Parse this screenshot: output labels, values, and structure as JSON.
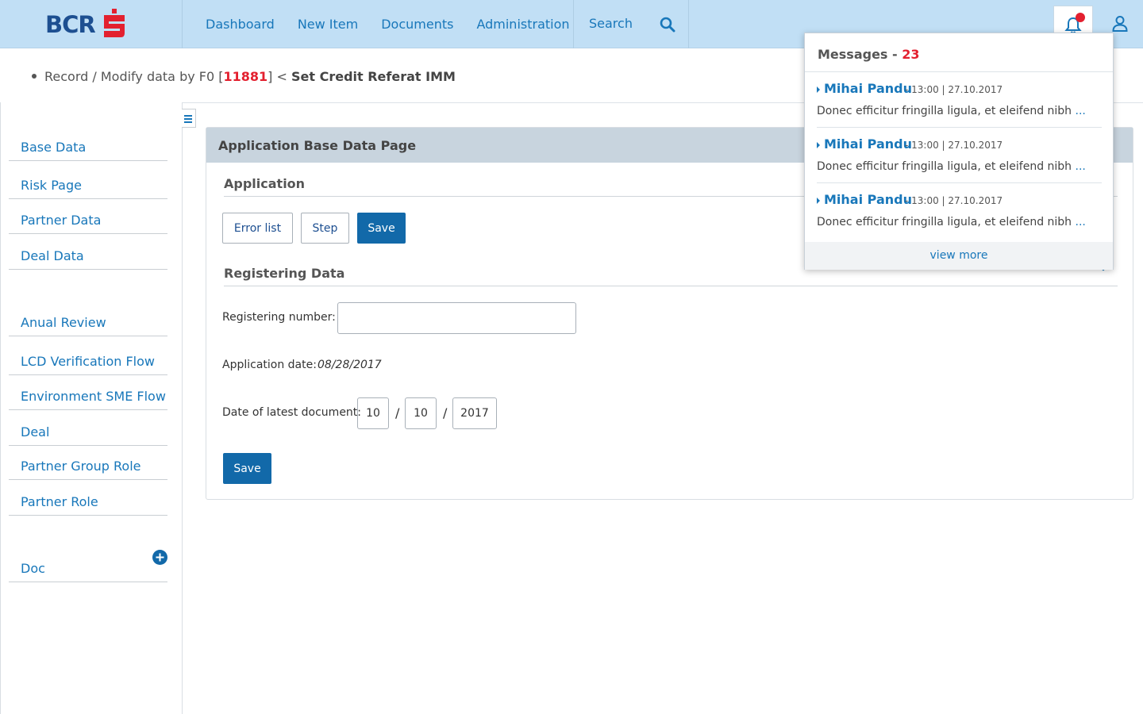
{
  "header": {
    "logo_text": "BCR",
    "brand_color": "#e3202f",
    "nav": [
      "Dashboard",
      "New Item",
      "Documents",
      "Administration"
    ],
    "search_label": "Search"
  },
  "breadcrumb": {
    "prefix": "Record / Modify data by F0 [",
    "record_id": "11881",
    "suffix": "] < ",
    "title": "Set Credit Referat IMM"
  },
  "sidebar": {
    "items": [
      {
        "label": "Base Data"
      },
      {
        "label": "Risk Page"
      },
      {
        "label": "Partner Data"
      },
      {
        "label": "Deal Data"
      },
      {
        "label": "Anual Review"
      },
      {
        "label": "LCD Verification Flow"
      },
      {
        "label": "Environment SME Flow"
      },
      {
        "label": "Deal"
      },
      {
        "label": "Partner Group Role"
      },
      {
        "label": "Partner Role"
      },
      {
        "label": "Doc"
      }
    ]
  },
  "main": {
    "panel_title": "Application Base Data Page",
    "application_title": "Application",
    "buttons": {
      "error_list": "Error list",
      "step": "Step",
      "save_top": "Save",
      "save_bottom": "Save"
    },
    "registering_title": "Registering Data",
    "registering_number_label": "Registering number:",
    "registering_number_value": "",
    "application_date_label": "Application date:",
    "application_date_value": "08/28/2017",
    "latest_doc_label": "Date of latest document:",
    "latest_doc": {
      "month": "10",
      "day": "10",
      "year": "2017",
      "separator": "/"
    }
  },
  "messages": {
    "title": "Messages - ",
    "count": "23",
    "items": [
      {
        "author": "Mihai Pandu",
        "time": "- 13:00 | 27.10.2017",
        "text": "Donec efficitur fringilla ligula, et eleifend nibh ",
        "ellipsis": "..."
      },
      {
        "author": "Mihai Pandu",
        "time": "- 13:00 | 27.10.2017",
        "text": "Donec efficitur fringilla ligula, et eleifend nibh ",
        "ellipsis": "..."
      },
      {
        "author": "Mihai Pandu",
        "time": "- 13:00 | 27.10.2017",
        "text": "Donec efficitur fringilla ligula, et eleifend nibh ",
        "ellipsis": "..."
      }
    ],
    "view_more": "view more"
  }
}
